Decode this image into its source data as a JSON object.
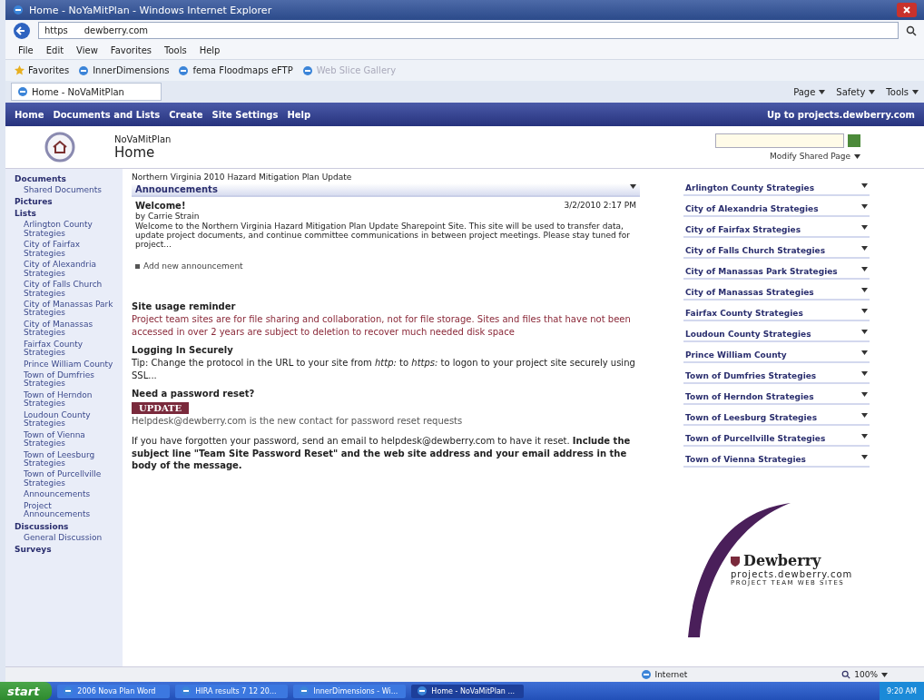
{
  "window": {
    "title": "Home - NoYaMitPlan - Windows Internet Explorer"
  },
  "address_bar": {
    "scheme": "https",
    "value": "dewberry.com"
  },
  "menu": [
    "File",
    "Edit",
    "View",
    "Favorites",
    "Tools",
    "Help"
  ],
  "favorites_bar": {
    "label": "Favorites",
    "links": [
      {
        "label": "InnerDimensions",
        "disabled": false
      },
      {
        "label": "fema Floodmaps eFTP",
        "disabled": false
      },
      {
        "label": "Web Slice Gallery",
        "disabled": true
      }
    ]
  },
  "tab": {
    "label": "Home - NoVaMitPlan"
  },
  "command_bar": [
    "Page",
    "Safety",
    "Tools"
  ],
  "site_nav": {
    "items": [
      "Home",
      "Documents and Lists",
      "Create",
      "Site Settings",
      "Help"
    ],
    "up_link": "Up to projects.dewberry.com"
  },
  "header": {
    "site_name": "NoVaMitPlan",
    "page_title": "Home",
    "modify_link": "Modify Shared Page"
  },
  "quick_launch": [
    {
      "label": "Documents",
      "kind": "heading"
    },
    {
      "label": "Shared Documents",
      "kind": "link"
    },
    {
      "label": "Pictures",
      "kind": "heading"
    },
    {
      "label": "Lists",
      "kind": "heading"
    },
    {
      "label": "Arlington County Strategies",
      "kind": "link"
    },
    {
      "label": "City of Fairfax Strategies",
      "kind": "link"
    },
    {
      "label": "City of Alexandria Strategies",
      "kind": "link"
    },
    {
      "label": "City of Falls Church Strategies",
      "kind": "link"
    },
    {
      "label": "City of Manassas Park Strategies",
      "kind": "link"
    },
    {
      "label": "City of Manassas Strategies",
      "kind": "link"
    },
    {
      "label": "Fairfax County Strategies",
      "kind": "link"
    },
    {
      "label": "Prince William County",
      "kind": "link"
    },
    {
      "label": "Town of Dumfries Strategies",
      "kind": "link"
    },
    {
      "label": "Town of Herndon Strategies",
      "kind": "link"
    },
    {
      "label": "Loudoun County Strategies",
      "kind": "link"
    },
    {
      "label": "Town of Vienna Strategies",
      "kind": "link"
    },
    {
      "label": "Town of Leesburg Strategies",
      "kind": "link"
    },
    {
      "label": "Town of Purcellville Strategies",
      "kind": "link"
    },
    {
      "label": "Announcements",
      "kind": "link"
    },
    {
      "label": "Project Announcements",
      "kind": "link"
    },
    {
      "label": "Discussions",
      "kind": "heading"
    },
    {
      "label": "General Discussion",
      "kind": "link"
    },
    {
      "label": "Surveys",
      "kind": "heading"
    }
  ],
  "main": {
    "page_heading": "Northern Virginia 2010 Hazard Mitigation Plan Update",
    "announcements": {
      "title": "Announcements",
      "item": {
        "title": "Welcome!",
        "author": "by Carrie Strain",
        "date": "3/2/2010 2:17 PM",
        "body": "Welcome to the Northern Virginia Hazard Mitigation Plan Update Sharepoint Site. This site will be used to transfer data, update project documents, and continue committee communications in between project meetings.  Please stay tuned for project..."
      },
      "add_link": "Add new announcement"
    },
    "reminder": {
      "title": "Site usage reminder",
      "text": "Project team sites are for file sharing and collaboration, not for file storage.  Sites and files that have not been accessed in over 2 years are subject to deletion to recover much needed disk space"
    },
    "secure": {
      "title": "Logging In Securely",
      "text": "Tip: Change the protocol in the URL to your site from *http:* to *https:* to logon to your project site securely using SSL..."
    },
    "reset": {
      "title": "Need a password reset?",
      "badge": "UPDATE",
      "contact": "Helpdesk@dewberry.com is the new contact for password reset requests",
      "text": "If you have forgotten your password, send an email to helpdesk@dewberry.com to have it reset.  **Include the subject line \"Team Site Password Reset\" and the web site address and your email address in the body of the message.**"
    }
  },
  "strategy_parts": [
    "Arlington County Strategies",
    "City of Alexandria Strategies",
    "City of Fairfax Strategies",
    "City of Falls Church Strategies",
    "City of Manassas Park Strategies",
    "City of Manassas Strategies",
    "Fairfax County Strategies",
    "Loudoun County Strategies",
    "Prince William County",
    "Town of Dumfries Strategies",
    "Town of Herndon Strategies",
    "Town of Leesburg Strategies",
    "Town of Purcellville Strategies",
    "Town of Vienna Strategies"
  ],
  "logo": {
    "name": "Dewberry",
    "url": "projects.dewberry.com",
    "tagline": "PROJECT TEAM WEB SITES"
  },
  "status_bar": {
    "zone": "Internet",
    "zoom": "100%"
  },
  "taskbar": {
    "start": "start",
    "buttons": [
      {
        "label": "2006 Nova Plan Word",
        "selected": false
      },
      {
        "label": "HIRA results 7 12 20...",
        "selected": false
      },
      {
        "label": "InnerDimensions - Wi...",
        "selected": false
      },
      {
        "label": "Home - NoVaMitPlan ...",
        "selected": true
      }
    ],
    "clock": "9:20 AM"
  }
}
